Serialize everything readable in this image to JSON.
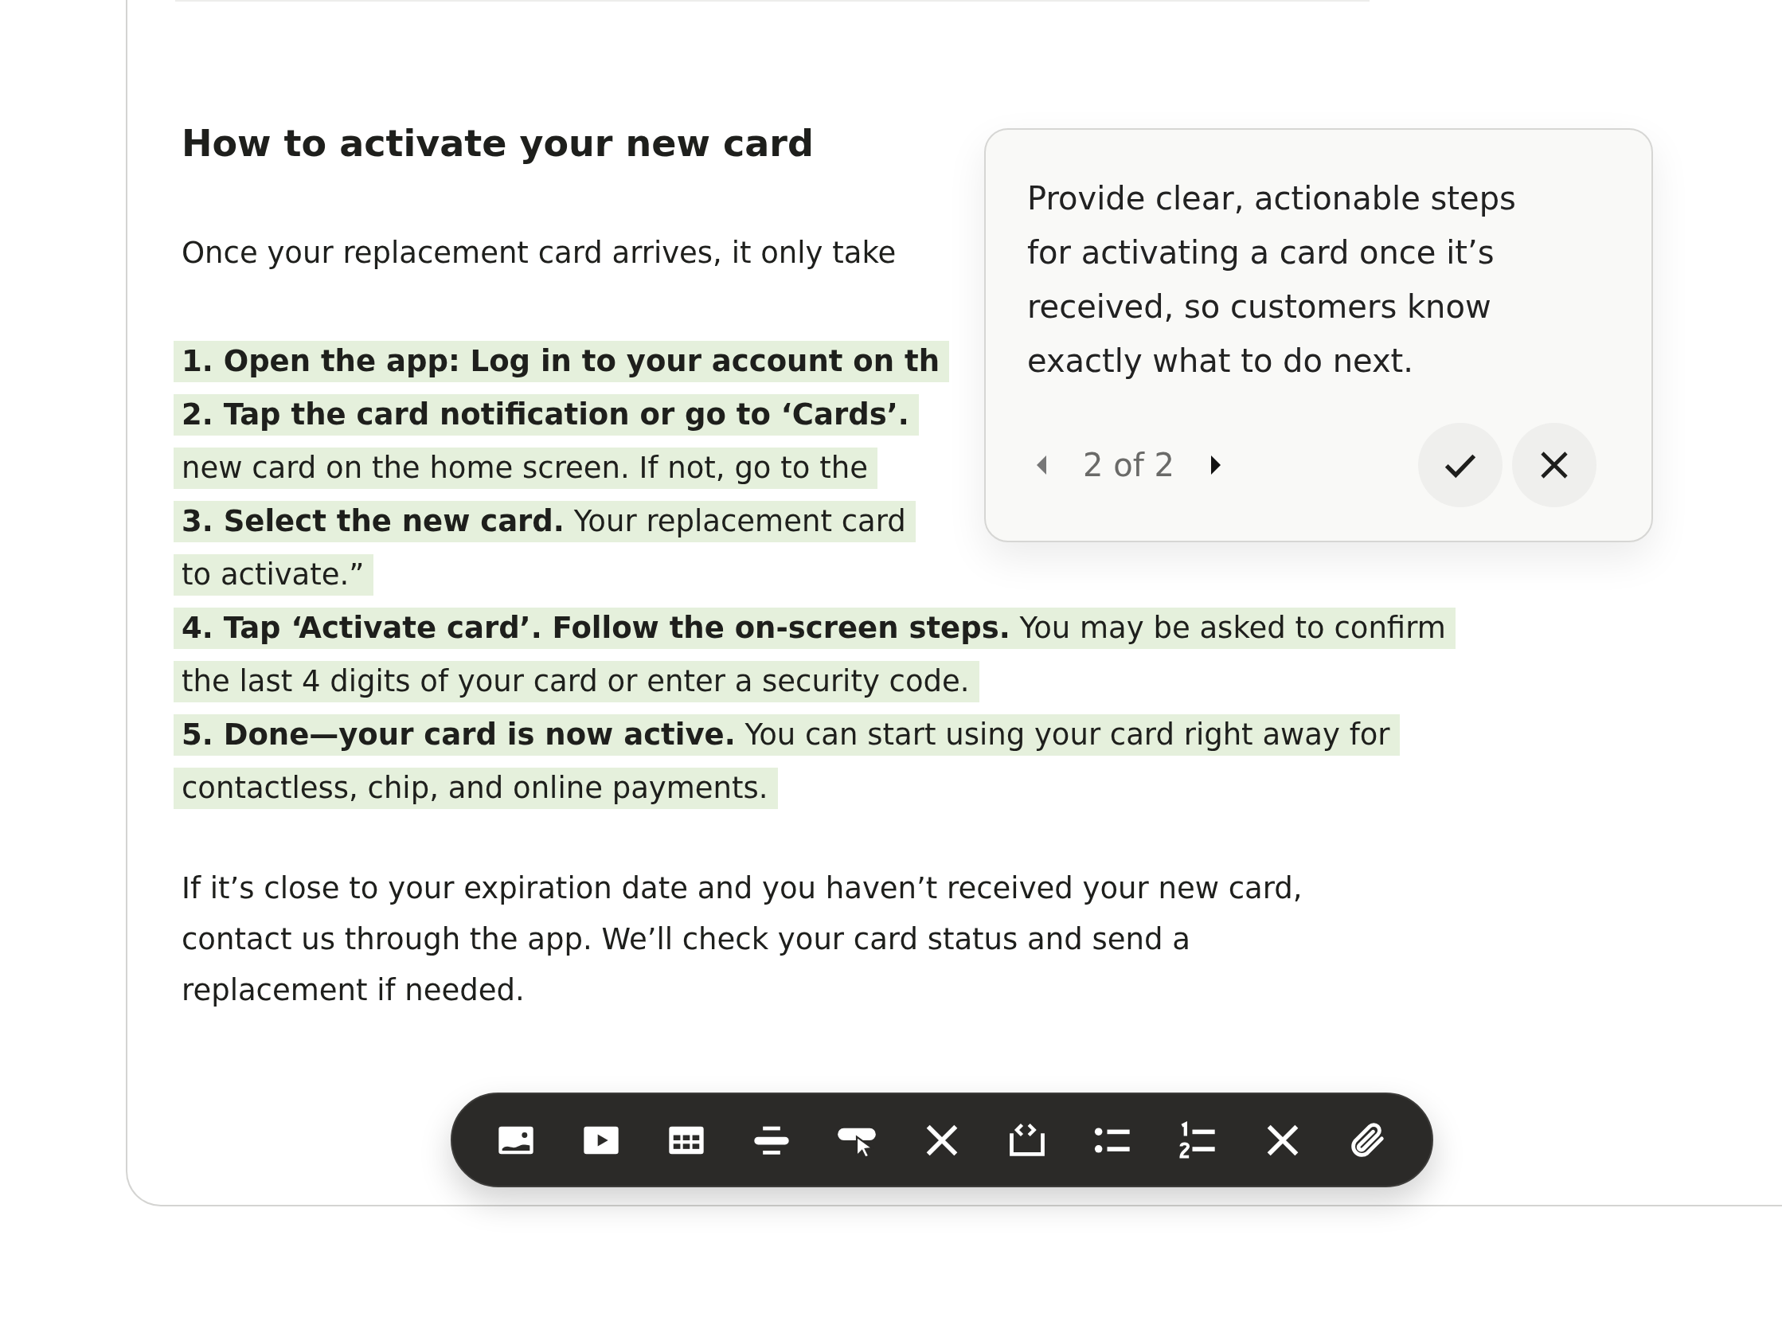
{
  "article": {
    "heading": "How to activate your new card",
    "intro": "Once your replacement card arrives, it only take",
    "steps": [
      {
        "highlighted": true,
        "lines": [
          "**1. Open the app: Log in to your account on th**"
        ]
      },
      {
        "highlighted": true,
        "lines": [
          "**2. Tap the card notification or go to ‘Cards’.**",
          "new card on the home screen. If not, go to the"
        ]
      },
      {
        "highlighted": true,
        "lines": [
          "**3. Select the new card.** Your replacement card",
          "to activate.”"
        ]
      },
      {
        "highlighted": true,
        "lines": [
          "**4. Tap ‘Activate card’. Follow the on-screen steps.** You may be asked to confirm",
          "the last 4 digits of your card or enter a security code."
        ]
      },
      {
        "highlighted": true,
        "lines": [
          "**5. Done—your card is now active.** You can start using your card right away for",
          "contactless, chip, and online payments."
        ]
      }
    ],
    "closing": "If it’s close to your expiration date and you haven’t received your new card, contact us through the app. We’ll check your card status and send a replacement if needed."
  },
  "suggestion": {
    "text": "Provide clear, actionable steps for activating a card once it’s received, so customers know exactly what to do next.",
    "pager": {
      "label": "2 of 2",
      "prev_disabled": true,
      "next_disabled": false
    }
  },
  "toolbar": {
    "buttons": [
      {
        "kind": "image"
      },
      {
        "kind": "video"
      },
      {
        "kind": "table"
      },
      {
        "kind": "divider"
      },
      {
        "kind": "button"
      },
      {
        "kind": "clear"
      },
      {
        "kind": "embed"
      },
      {
        "kind": "bullets"
      },
      {
        "kind": "numbers"
      },
      {
        "kind": "clear"
      },
      {
        "kind": "attach"
      }
    ]
  }
}
